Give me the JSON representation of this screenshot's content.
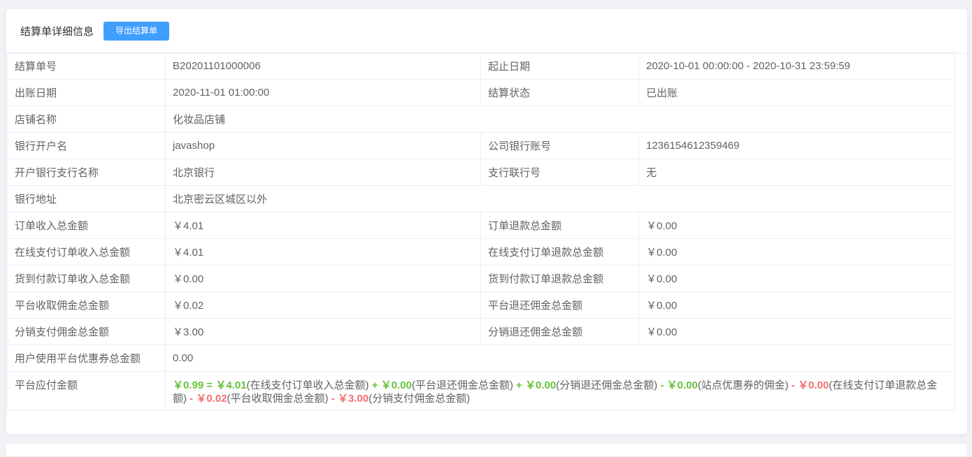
{
  "header": {
    "title": "结算单详细信息",
    "export_label": "导出结算单"
  },
  "rows": {
    "settlement_no": {
      "label": "结算单号",
      "value": "B20201101000006"
    },
    "period": {
      "label": "起止日期",
      "value": "2020-10-01 00:00:00 - 2020-10-31 23:59:59"
    },
    "bill_date": {
      "label": "出账日期",
      "value": "2020-11-01 01:00:00"
    },
    "status": {
      "label": "结算状态",
      "value": "已出账"
    },
    "shop_name": {
      "label": "店铺名称",
      "value": "化妆品店铺"
    },
    "bank_account_name": {
      "label": "银行开户名",
      "value": "javashop"
    },
    "company_account": {
      "label": "公司银行账号",
      "value": "1236154612359469"
    },
    "bank_branch": {
      "label": "开户银行支行名称",
      "value": "北京银行"
    },
    "branch_code": {
      "label": "支行联行号",
      "value": "无"
    },
    "bank_address": {
      "label": "银行地址",
      "value": "北京密云区城区以外"
    },
    "order_income": {
      "label": "订单收入总金额",
      "value": "￥4.01"
    },
    "order_refund": {
      "label": "订单退款总金额",
      "value": "￥0.00"
    },
    "online_income": {
      "label": "在线支付订单收入总金额",
      "value": "￥4.01"
    },
    "online_refund": {
      "label": "在线支付订单退款总金额",
      "value": "￥0.00"
    },
    "cod_income": {
      "label": "货到付款订单收入总金额",
      "value": "￥0.00"
    },
    "cod_refund": {
      "label": "货到付款订单退款总金额",
      "value": "￥0.00"
    },
    "platform_commission": {
      "label": "平台收取佣金总金额",
      "value": "￥0.02"
    },
    "platform_commission_refund": {
      "label": "平台退还佣金总金额",
      "value": "￥0.00"
    },
    "distribution_commission": {
      "label": "分销支付佣金总金额",
      "value": "￥3.00"
    },
    "distribution_commission_refund": {
      "label": "分销退还佣金总金额",
      "value": "￥0.00"
    },
    "coupon_total": {
      "label": "用户使用平台优惠券总金额",
      "value": "0.00"
    },
    "payable": {
      "label": "平台应付金额",
      "result": "￥0.99",
      "eq": "=",
      "t1": "￥4.01",
      "d1": "(在线支付订单收入总金额)",
      "op2": "+",
      "t2": "￥0.00",
      "d2": "(平台退还佣金总金额)",
      "op3": "+",
      "t3": "￥0.00",
      "d3": "(分销退还佣金总金额)",
      "op4": "-",
      "t4": "￥0.00",
      "d4": "(站点优惠券的佣金)",
      "op5": "-",
      "t5": "￥0.00",
      "d5": "(在线支付订单退款总金额)",
      "op6": "-",
      "t6": "￥0.02",
      "d6": "(平台收取佣金总金额)",
      "op7": "-",
      "t7": "￥3.00",
      "d7": "(分销支付佣金总金额)"
    }
  },
  "colors": {
    "primary": "#409eff",
    "add": "#67c23a",
    "subtract": "#f56c6c"
  }
}
